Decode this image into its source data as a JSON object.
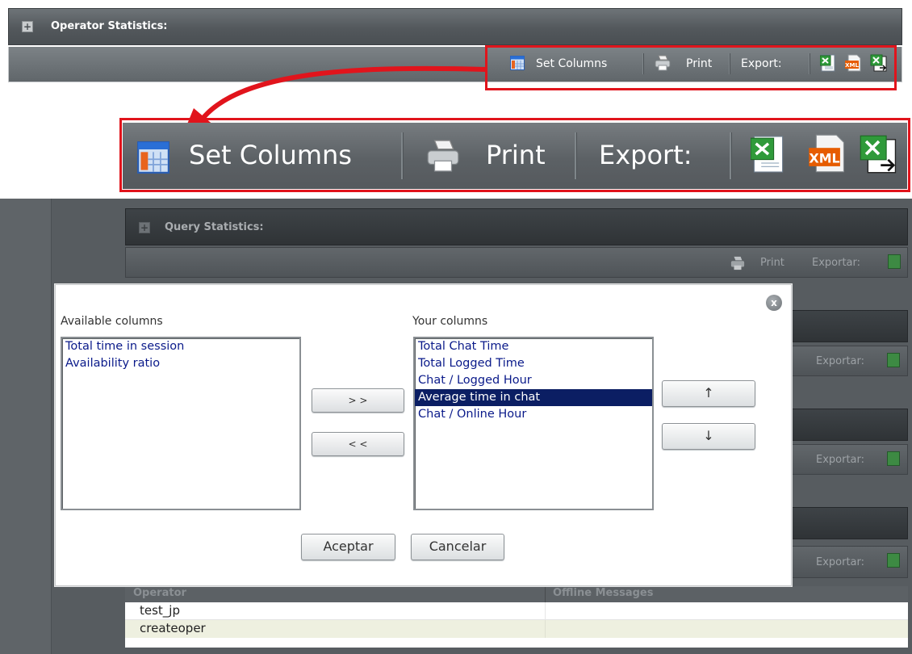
{
  "operator_panel": {
    "title": "Operator Statistics:",
    "toolbar": {
      "set_columns": "Set Columns",
      "print": "Print",
      "export": "Export:"
    }
  },
  "zoom_toolbar": {
    "set_columns": "Set Columns",
    "print": "Print",
    "export": "Export:",
    "xml_badge": "XML"
  },
  "query_panel": {
    "title": "Query Statistics:",
    "print": "Print",
    "export": "Exportar:"
  },
  "background_rows": {
    "export_labels": [
      "Exportar:",
      "Exportar:",
      "Exportar:"
    ],
    "table_headers": [
      "Operator",
      "Offline Messages"
    ],
    "rows": [
      "test_jp",
      "createoper"
    ]
  },
  "dialog": {
    "close_glyph": "x",
    "available_label": "Available columns",
    "available_items": [
      "Total time in session",
      "Availability ratio"
    ],
    "your_label": "Your columns",
    "your_items": [
      "Total Chat Time",
      "Total Logged Time",
      "Chat / Logged Hour",
      "Average time in chat",
      "Chat / Online Hour"
    ],
    "selected_index": 3,
    "add_button": "> >",
    "remove_button": "< <",
    "up_button": "↑",
    "down_button": "↓",
    "accept_button": "Aceptar",
    "cancel_button": "Cancelar"
  },
  "colors": {
    "highlight": "#e1141c",
    "selection": "#0b1e63",
    "header_dark": "#2f3336"
  },
  "icons": [
    "plus-icon",
    "calendar-columns-icon",
    "printer-icon",
    "excel-icon",
    "xml-icon",
    "excel-export-icon",
    "close-icon"
  ]
}
